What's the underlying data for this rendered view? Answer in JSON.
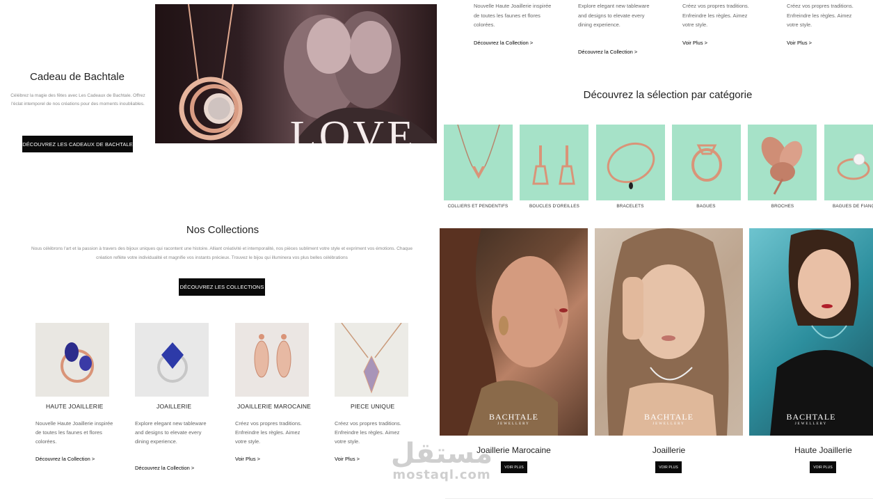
{
  "gift": {
    "title": "Cadeau de Bachtale",
    "description": "Célébrez la magie des fêtes avec Les Cadeaux de Bachtale. Offrez l'éclat intemporel de nos créations pour des moments inoubliables.",
    "button": "DÉCOUVREZ LES CADEAUX DE BACHTALE"
  },
  "hero": {
    "overlay_text": "LOVE"
  },
  "collections": {
    "title": "Nos Collections",
    "description": "Nous célébrons l'art et la passion à travers des bijoux uniques qui racontent une histoire. Alliant créativité et intemporalité, nos pièces subliment votre style et expriment vos émotions. Chaque création reflète votre individualité et magnifie vos instants précieux. Trouvez le bijou qui illuminera vos plus belles célébrations",
    "button": "DÉCOUVREZ LES COLLECTIONS",
    "cards": [
      {
        "title": "HAUTE JOAILLERIE",
        "desc": "Nouvelle Haute Joaillerie inspirée de toutes les faunes et flores colorées.",
        "link": "Découvrez la Collection >"
      },
      {
        "title": "JOAILLERIE",
        "desc": "Explore elegant new tableware and designs to elevate every dining experience.",
        "link": "Découvrez la Collection >"
      },
      {
        "title": "JOAILLERIE MAROCAINE",
        "desc": "Créez vos propres traditions. Enfreindre les règles. Aimez votre style.",
        "link": "Voir Plus >"
      },
      {
        "title": "PIECE UNIQUE",
        "desc": "Créez vos propres traditions. Enfreindre les règles. Aimez votre style.",
        "link": "Voir Plus >"
      }
    ]
  },
  "top_columns": [
    {
      "desc": "Nouvelle Haute Joaillerie inspirée de toutes les faunes et flores colorées.",
      "link": "Découvrez la Collection >"
    },
    {
      "desc": "Explore elegant new tableware and designs to elevate every dining experience.",
      "link": "Découvrez la Collection >"
    },
    {
      "desc": "Créez vos propres traditions. Enfreindre les règles. Aimez votre style.",
      "link": "Voir Plus >"
    },
    {
      "desc": "Créez vos propres traditions. Enfreindre les règles. Aimez votre style.",
      "link": "Voir Plus >"
    }
  ],
  "categories": {
    "title": "Découvrez la sélection par catégorie",
    "items": [
      {
        "label": "COLLIERS ET PENDENTIFS"
      },
      {
        "label": "BOUCLES D'OREILLES"
      },
      {
        "label": "BRACELETS"
      },
      {
        "label": "BAGUES"
      },
      {
        "label": "BROCHES"
      },
      {
        "label": "BAGUES DE FIANÇAILLES"
      }
    ]
  },
  "models": [
    {
      "title": "Joaillerie Marocaine",
      "button": "VOIR PLUS",
      "brand": "BACHTALE",
      "brand_sub": "JEWELLERY"
    },
    {
      "title": "Joaillerie",
      "button": "VOIR PLUS",
      "brand": "BACHTALE",
      "brand_sub": "JEWELLERY"
    },
    {
      "title": "Haute Joaillerie",
      "button": "VOIR PLUS",
      "brand": "BACHTALE",
      "brand_sub": "JEWELLERY"
    }
  ],
  "watermark": {
    "arabic": "مستقل",
    "latin": "mostaql.com"
  },
  "colors": {
    "mint": "#a6e2c8",
    "button_black": "#0a0a0a",
    "rose_gold": "#d9957a"
  }
}
